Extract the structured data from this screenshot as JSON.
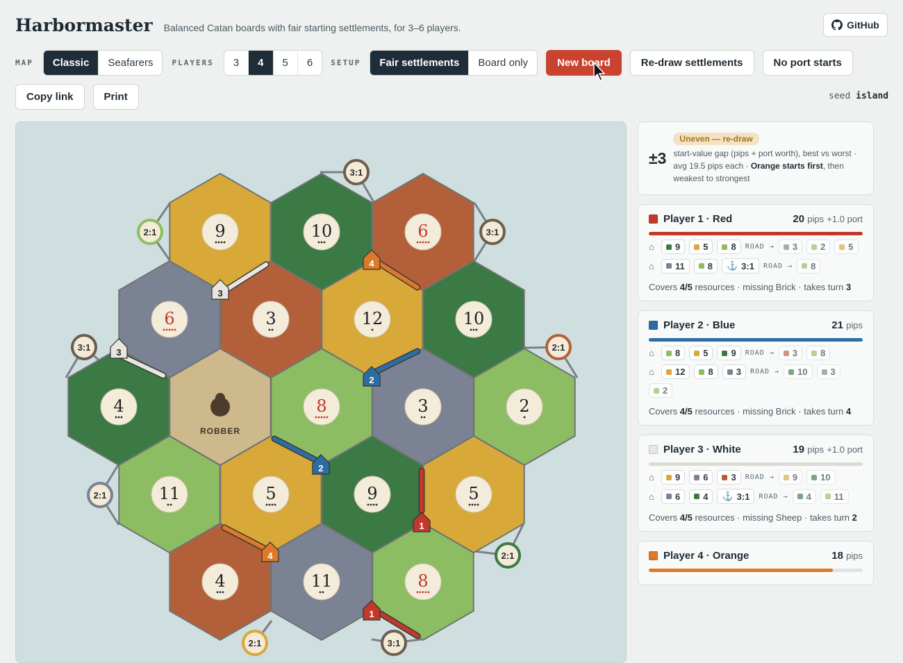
{
  "app": {
    "title": "Harbormaster",
    "tagline": "Balanced Catan boards with fair starting settlements, for 3–6 players.",
    "github": "GitHub"
  },
  "controls": {
    "map_label": "MAP",
    "map_options": [
      "Classic",
      "Seafarers"
    ],
    "map_selected": "Classic",
    "players_label": "PLAYERS",
    "players_options": [
      "3",
      "4",
      "5",
      "6"
    ],
    "players_selected": "4",
    "setup_label": "SETUP",
    "setup_options": [
      "Fair settlements",
      "Board only"
    ],
    "setup_selected": "Fair settlements",
    "new_board": "New board",
    "redraw": "Re-draw settlements",
    "no_port": "No port starts",
    "copy_link": "Copy link",
    "print": "Print",
    "seed_label": "seed",
    "seed_value": "island"
  },
  "colors": {
    "forest": "#3b7a44",
    "pasture": "#8dbd62",
    "fields": "#d8a838",
    "hills": "#b3603a",
    "mountains": "#7b8293",
    "desert": "#cdb98c",
    "red": "#c0392b",
    "blue": "#2e6da4",
    "white": "#e8e6df",
    "orange": "#dd7a2a"
  },
  "board": {
    "robber_label": "ROBBER",
    "tiles": [
      {
        "res": "fields",
        "num": "9"
      },
      {
        "res": "forest",
        "num": "10"
      },
      {
        "res": "hills",
        "num": "6"
      },
      {
        "res": "mountains",
        "num": "6"
      },
      {
        "res": "hills",
        "num": "3"
      },
      {
        "res": "fields",
        "num": "12"
      },
      {
        "res": "forest",
        "num": "10"
      },
      {
        "res": "forest",
        "num": "4"
      },
      {
        "res": "desert",
        "num": ""
      },
      {
        "res": "pasture",
        "num": "8"
      },
      {
        "res": "mountains",
        "num": "3"
      },
      {
        "res": "pasture",
        "num": "2"
      },
      {
        "res": "pasture",
        "num": "11"
      },
      {
        "res": "fields",
        "num": "5"
      },
      {
        "res": "forest",
        "num": "9"
      },
      {
        "res": "fields",
        "num": "5"
      },
      {
        "res": "hills",
        "num": "4"
      },
      {
        "res": "mountains",
        "num": "11"
      },
      {
        "res": "pasture",
        "num": "8"
      }
    ],
    "ports": [
      {
        "label": "3:1",
        "res": "generic"
      },
      {
        "label": "2:1",
        "res": "pasture"
      },
      {
        "label": "3:1",
        "res": "generic"
      },
      {
        "label": "3:1",
        "res": "generic"
      },
      {
        "label": "2:1",
        "res": "hills"
      },
      {
        "label": "2:1",
        "res": "mountains"
      },
      {
        "label": "2:1",
        "res": "forest"
      },
      {
        "label": "2:1",
        "res": "fields"
      },
      {
        "label": "3:1",
        "res": "generic"
      }
    ],
    "settlements": [
      {
        "player": "white",
        "num": "3"
      },
      {
        "player": "white",
        "num": "3"
      },
      {
        "player": "orange",
        "num": "4"
      },
      {
        "player": "blue",
        "num": "2"
      },
      {
        "player": "blue",
        "num": "2"
      },
      {
        "player": "red",
        "num": "1"
      },
      {
        "player": "orange",
        "num": "4"
      },
      {
        "player": "red",
        "num": "1"
      }
    ]
  },
  "summary": {
    "gap": "±3",
    "badge": "Uneven — re-draw",
    "text_a": "start-value gap (pips + port worth), best vs worst · avg 19.5 pips each · ",
    "first": "Orange starts first",
    "text_b": ", then weakest to strongest"
  },
  "players": [
    {
      "name": "Player 1 · Red",
      "color": "#c0392b",
      "pips": "20",
      "pips_label": "pips",
      "port": "+1.0 port",
      "bar": 1.0,
      "s1": [
        {
          "c": "forest",
          "v": "9"
        },
        {
          "c": "fields",
          "v": "5"
        },
        {
          "c": "pasture",
          "v": "8"
        }
      ],
      "r1": [
        {
          "c": "mountains",
          "v": "3"
        },
        {
          "c": "pasture",
          "v": "2"
        },
        {
          "c": "fields",
          "v": "5"
        }
      ],
      "s2": [
        {
          "c": "mountains",
          "v": "11"
        },
        {
          "c": "pasture",
          "v": "8"
        }
      ],
      "s2port": "3:1",
      "r2": [
        {
          "c": "pasture",
          "v": "8"
        }
      ],
      "covers": "Covers ",
      "cov_n": "4/5",
      "missing": " resources · missing Brick · takes turn ",
      "turn": "3"
    },
    {
      "name": "Player 2 · Blue",
      "color": "#2e6da4",
      "pips": "21",
      "pips_label": "pips",
      "port": "",
      "bar": 1.0,
      "s1": [
        {
          "c": "pasture",
          "v": "8"
        },
        {
          "c": "fields",
          "v": "5"
        },
        {
          "c": "forest",
          "v": "9"
        }
      ],
      "r1": [
        {
          "c": "hills",
          "v": "3"
        },
        {
          "c": "pasture",
          "v": "8"
        }
      ],
      "s2": [
        {
          "c": "fields",
          "v": "12"
        },
        {
          "c": "pasture",
          "v": "8"
        },
        {
          "c": "mountains",
          "v": "3"
        }
      ],
      "s2port": "",
      "r2": [
        {
          "c": "forest",
          "v": "10"
        },
        {
          "c": "mountains",
          "v": "3"
        },
        {
          "c": "pasture",
          "v": "2"
        }
      ],
      "covers": "Covers ",
      "cov_n": "4/5",
      "missing": " resources · missing Brick · takes turn ",
      "turn": "4"
    },
    {
      "name": "Player 3 · White",
      "color": "#e8e6df",
      "pips": "19",
      "pips_label": "pips",
      "port": "+1.0 port",
      "bar": 1.0,
      "s1": [
        {
          "c": "fields",
          "v": "9"
        },
        {
          "c": "mountains",
          "v": "6"
        },
        {
          "c": "hills",
          "v": "3"
        }
      ],
      "r1": [
        {
          "c": "fields",
          "v": "9"
        },
        {
          "c": "forest",
          "v": "10"
        }
      ],
      "s2": [
        {
          "c": "mountains",
          "v": "6"
        },
        {
          "c": "forest",
          "v": "4"
        }
      ],
      "s2port": "3:1",
      "r2": [
        {
          "c": "forest",
          "v": "4"
        },
        {
          "c": "pasture",
          "v": "11"
        }
      ],
      "covers": "Covers ",
      "cov_n": "4/5",
      "missing": " resources · missing Sheep · takes turn ",
      "turn": "2"
    },
    {
      "name": "Player 4 · Orange",
      "color": "#dd7a2a",
      "pips": "18",
      "pips_label": "pips",
      "port": "",
      "bar": 0.86
    }
  ],
  "road_label": "ROAD →"
}
